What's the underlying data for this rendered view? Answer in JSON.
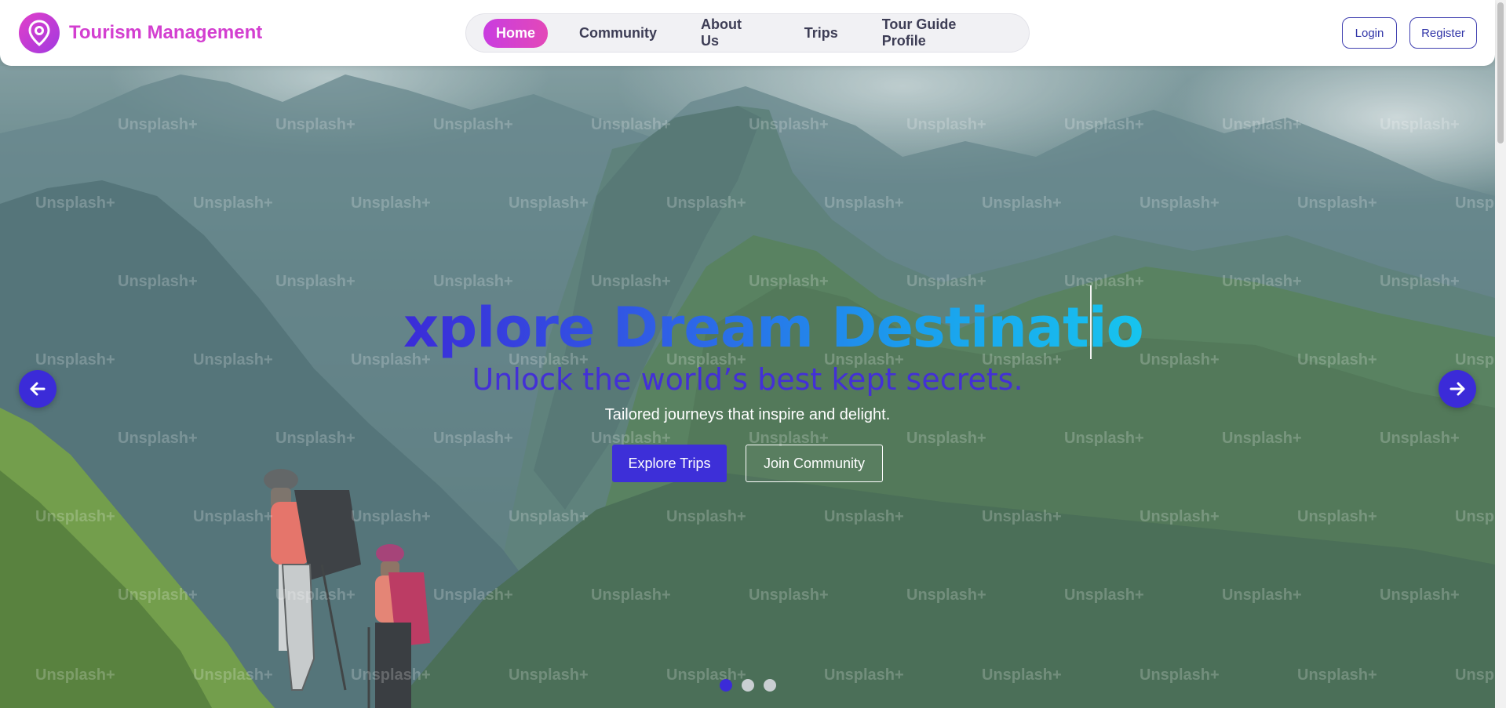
{
  "brand": {
    "name": "Tourism Management",
    "logo_icon": "map-pin-icon"
  },
  "nav": {
    "items": [
      {
        "label": "Home",
        "active": true
      },
      {
        "label": "Community",
        "active": false
      },
      {
        "label": "About Us",
        "active": false
      },
      {
        "label": "Trips",
        "active": false
      },
      {
        "label": "Tour Guide Profile",
        "active": false
      }
    ]
  },
  "auth": {
    "login_label": "Login",
    "register_label": "Register"
  },
  "hero": {
    "headline": "xplore Dream Destinatio",
    "subheadline": "Unlock the world’s best kept secrets.",
    "tagline": "Tailored journeys that inspire and delight.",
    "primary_cta": "Explore Trips",
    "secondary_cta": "Join Community",
    "watermark": "Unsplash+",
    "prev_icon": "arrow-left-icon",
    "next_icon": "arrow-right-icon",
    "slides": 3,
    "active_slide": 1
  },
  "colors": {
    "brand_magenta": "#d33fd0",
    "accent_indigo": "#3b2bd8",
    "headline_gradient_end": "#17c4ee"
  }
}
